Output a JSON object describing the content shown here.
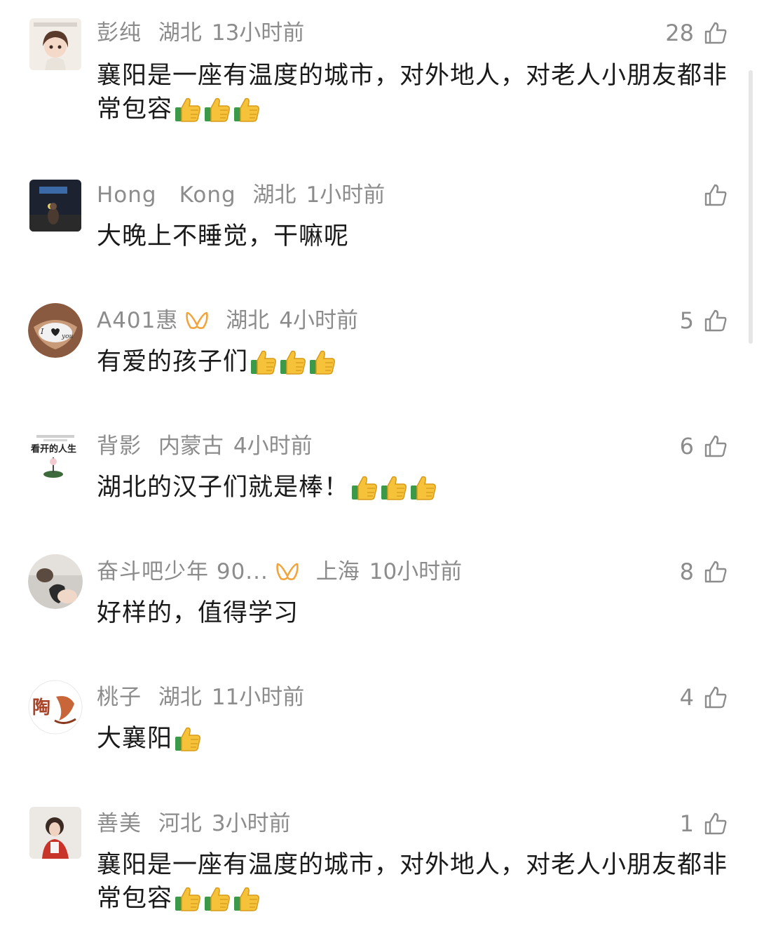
{
  "comments": [
    {
      "name": "彭纯",
      "region": "湖北",
      "time": "13小时前",
      "likes": "28",
      "text": "襄阳是一座有温度的城市，对外地人，对老人小朋友都非常包容",
      "thumbs": 3,
      "vip": false
    },
    {
      "name": "Hong　Kong",
      "region": "湖北",
      "time": "1小时前",
      "likes": "",
      "text": "大晚上不睡觉，干嘛呢",
      "thumbs": 0,
      "vip": false
    },
    {
      "name": "A401惠",
      "region": "湖北",
      "time": "4小时前",
      "likes": "5",
      "text": "有爱的孩子们",
      "thumbs": 3,
      "vip": true
    },
    {
      "name": "背影",
      "region": "内蒙古",
      "time": "4小时前",
      "likes": "6",
      "text": "湖北的汉子们就是棒！",
      "thumbs": 3,
      "vip": false
    },
    {
      "name": "奋斗吧少年 90...",
      "region": "上海",
      "time": "10小时前",
      "likes": "8",
      "text": "好样的，值得学习",
      "thumbs": 0,
      "vip": true
    },
    {
      "name": "桃子",
      "region": "湖北",
      "time": "11小时前",
      "likes": "4",
      "text": "大襄阳",
      "thumbs": 1,
      "vip": false
    },
    {
      "name": "善美",
      "region": "河北",
      "time": "3小时前",
      "likes": "1",
      "text": "襄阳是一座有温度的城市，对外地人，对老人小朋友都非常包容",
      "thumbs": 3,
      "vip": false
    }
  ],
  "avatars": {
    "c3_text": "I ♥ you",
    "c4_text": "看开的人生",
    "c6_text": "陶"
  }
}
